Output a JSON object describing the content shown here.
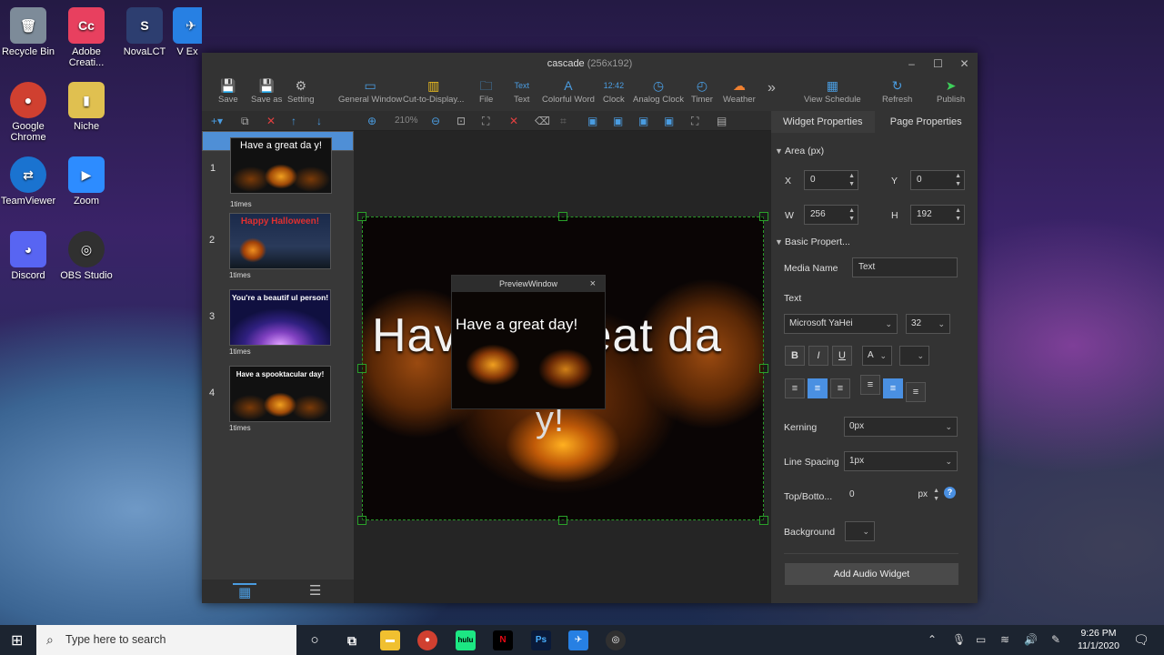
{
  "desktop": {
    "icons": [
      {
        "label": "Recycle Bin",
        "glyph": "🗑",
        "color": "#7d8b99"
      },
      {
        "label": "Adobe Creati...",
        "glyph": "Cc",
        "color": "#e8405f"
      },
      {
        "label": "NovaLCT",
        "glyph": "S",
        "color": "#2d3e70"
      },
      {
        "label": "V Ex",
        "glyph": "✈",
        "color": "#2780e3"
      },
      {
        "label": "Google Chrome",
        "glyph": "●",
        "color": "#d04030"
      },
      {
        "label": "Niche",
        "glyph": "▮",
        "color": "#e0c050"
      },
      {
        "label": "TeamViewer",
        "glyph": "⇄",
        "color": "#1a73d0"
      },
      {
        "label": "Zoom",
        "glyph": "▶",
        "color": "#2d8cff"
      },
      {
        "label": "Discord",
        "glyph": "◕",
        "color": "#5865f2"
      },
      {
        "label": "OBS Studio",
        "glyph": "◎",
        "color": "#303030"
      }
    ]
  },
  "window": {
    "title": "cascade",
    "size": "(256x192)"
  },
  "toolbar": {
    "items": [
      {
        "label": "Save",
        "glyph": "💾",
        "tone": ""
      },
      {
        "label": "Save as",
        "glyph": "💾",
        "tone": ""
      },
      {
        "label": "Setting",
        "glyph": "⚙",
        "tone": ""
      },
      {
        "label": "General Window",
        "glyph": "▭",
        "tone": "blue"
      },
      {
        "label": "Cut-to-Display...",
        "glyph": "▥",
        "tone": "yellow"
      },
      {
        "label": "File",
        "glyph": "🗀",
        "tone": "blue"
      },
      {
        "label": "Text",
        "glyph": "Text",
        "tone": "blue"
      },
      {
        "label": "Colorful Word",
        "glyph": "A",
        "tone": "blue"
      },
      {
        "label": "Clock",
        "glyph": "12:42",
        "tone": "blue"
      },
      {
        "label": "Analog Clock",
        "glyph": "◷",
        "tone": "blue"
      },
      {
        "label": "Timer",
        "glyph": "◴",
        "tone": "blue"
      },
      {
        "label": "Weather",
        "glyph": "☁",
        "tone": "orange"
      },
      {
        "label": "View Schedule",
        "glyph": "▦",
        "tone": "blue"
      },
      {
        "label": "Refresh",
        "glyph": "↻",
        "tone": "blue"
      },
      {
        "label": "Publish",
        "glyph": "➤",
        "tone": "green"
      }
    ],
    "more": "»"
  },
  "subbar": {
    "zoom": "210%"
  },
  "pages": [
    {
      "num": "1",
      "caption": "1times",
      "text": "Have a great da y!",
      "bg": "pumpkin"
    },
    {
      "num": "2",
      "caption": "1times",
      "text": "Happy Halloween!",
      "bg": "night"
    },
    {
      "num": "3",
      "caption": "1times",
      "text": "You're a beautif ul person!",
      "bg": "rays"
    },
    {
      "num": "4",
      "caption": "1times",
      "text": "Have a spooktacular day!",
      "bg": "pumpkin"
    }
  ],
  "canvas": {
    "text": "Have a great da",
    "text2": "y!"
  },
  "preview": {
    "title": "PreviewWindow",
    "text": "Have a great day!"
  },
  "properties": {
    "tabs": [
      "Widget Properties",
      "Page Properties"
    ],
    "area_label": "Area (px)",
    "x_label": "X",
    "x": "0",
    "y_label": "Y",
    "y": "0",
    "w_label": "W",
    "w": "256",
    "h_label": "H",
    "h": "192",
    "basic_label": "Basic Propert...",
    "media_name_label": "Media Name",
    "media_name": "Text",
    "text_label": "Text",
    "font": "Microsoft YaHei",
    "font_size": "32",
    "bold": "B",
    "italic": "I",
    "underline": "U",
    "color": "A",
    "kerning_label": "Kerning",
    "kerning": "0px",
    "line_spacing_label": "Line Spacing",
    "line_spacing": "1px",
    "top_bottom_label": "Top/Botto...",
    "top_bottom": "0",
    "top_bottom_unit": "px",
    "background_label": "Background",
    "add_audio": "Add Audio Widget"
  },
  "taskbar": {
    "search_placeholder": "Type here to search",
    "time": "9:26 PM",
    "date": "11/1/2020"
  }
}
